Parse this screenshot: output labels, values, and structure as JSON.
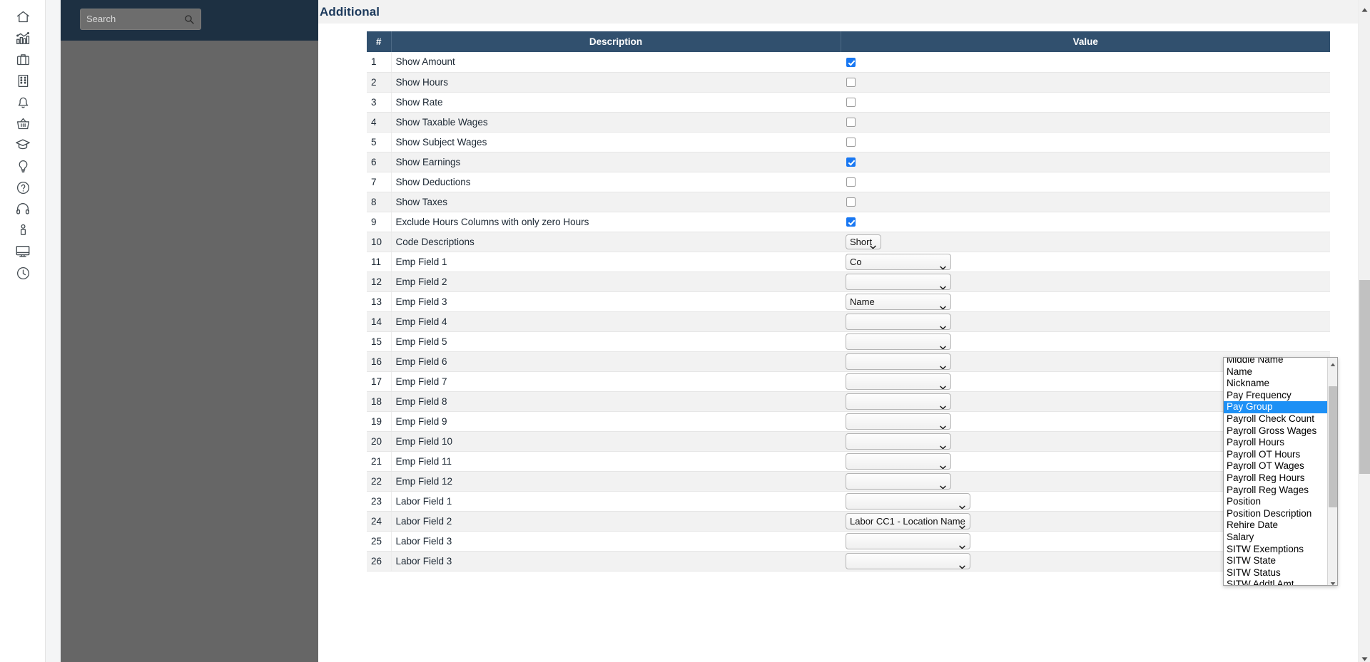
{
  "app": {
    "search": {
      "placeholder": "Search",
      "value": ""
    }
  },
  "sidebar": {
    "icons": [
      {
        "name": "home-icon",
        "label": "Home"
      },
      {
        "name": "analytics-icon",
        "label": "Analytics"
      },
      {
        "name": "briefcase-icon",
        "label": "Briefcase"
      },
      {
        "name": "company-building-icon",
        "label": "Company"
      },
      {
        "name": "bell-icon",
        "label": "Notifications"
      },
      {
        "name": "basket-icon",
        "label": "Marketplace"
      },
      {
        "name": "graduation-cap-icon",
        "label": "Learning"
      },
      {
        "name": "lightbulb-icon",
        "label": "Ideas"
      },
      {
        "name": "question-circle-icon",
        "label": "Help"
      },
      {
        "name": "headset-icon",
        "label": "Support"
      },
      {
        "name": "person-icon",
        "label": "Profile"
      },
      {
        "name": "monitor-icon",
        "label": "Display"
      },
      {
        "name": "clock-icon",
        "label": "Time"
      }
    ]
  },
  "section": {
    "title": "Additional"
  },
  "table": {
    "headers": {
      "num": "#",
      "description": "Description",
      "value": "Value"
    },
    "rows": [
      {
        "num": "1",
        "description": "Show Amount",
        "type": "checkbox",
        "checked": true
      },
      {
        "num": "2",
        "description": "Show Hours",
        "type": "checkbox",
        "checked": false
      },
      {
        "num": "3",
        "description": "Show Rate",
        "type": "checkbox",
        "checked": false
      },
      {
        "num": "4",
        "description": "Show Taxable Wages",
        "type": "checkbox",
        "checked": false
      },
      {
        "num": "5",
        "description": "Show Subject Wages",
        "type": "checkbox",
        "checked": false
      },
      {
        "num": "6",
        "description": "Show Earnings",
        "type": "checkbox",
        "checked": true
      },
      {
        "num": "7",
        "description": "Show Deductions",
        "type": "checkbox",
        "checked": false
      },
      {
        "num": "8",
        "description": "Show Taxes",
        "type": "checkbox",
        "checked": false
      },
      {
        "num": "9",
        "description": "Exclude Hours Columns with only zero Hours",
        "type": "checkbox",
        "checked": true
      },
      {
        "num": "10",
        "description": "Code Descriptions",
        "type": "select-short",
        "value": "Short"
      },
      {
        "num": "11",
        "description": "Emp Field 1",
        "type": "select-emp",
        "value": "Co"
      },
      {
        "num": "12",
        "description": "Emp Field 2",
        "type": "select-emp",
        "value": ""
      },
      {
        "num": "13",
        "description": "Emp Field 3",
        "type": "select-emp",
        "value": "Name"
      },
      {
        "num": "14",
        "description": "Emp Field 4",
        "type": "select-emp",
        "value": "",
        "open": true
      },
      {
        "num": "15",
        "description": "Emp Field 5",
        "type": "select-emp",
        "value": ""
      },
      {
        "num": "16",
        "description": "Emp Field 6",
        "type": "select-emp",
        "value": ""
      },
      {
        "num": "17",
        "description": "Emp Field 7",
        "type": "select-emp",
        "value": ""
      },
      {
        "num": "18",
        "description": "Emp Field 8",
        "type": "select-emp",
        "value": ""
      },
      {
        "num": "19",
        "description": "Emp Field 9",
        "type": "select-emp",
        "value": ""
      },
      {
        "num": "20",
        "description": "Emp Field 10",
        "type": "select-emp",
        "value": ""
      },
      {
        "num": "21",
        "description": "Emp Field 11",
        "type": "select-emp",
        "value": ""
      },
      {
        "num": "22",
        "description": "Emp Field 12",
        "type": "select-emp",
        "value": ""
      },
      {
        "num": "23",
        "description": "Labor Field 1",
        "type": "select-labor",
        "value": ""
      },
      {
        "num": "24",
        "description": "Labor Field 2",
        "type": "select-labor",
        "value": "Labor CC1 - Location Name"
      },
      {
        "num": "25",
        "description": "Labor Field 3",
        "type": "select-labor",
        "value": ""
      },
      {
        "num": "26",
        "description": "Labor Field 3",
        "type": "select-labor",
        "value": ""
      }
    ]
  },
  "dropdown": {
    "owner_row": "14",
    "selected": "Pay Group",
    "options": [
      "Middle Name",
      "Name",
      "Nickname",
      "Pay Frequency",
      "Pay Group",
      "Payroll Check Count",
      "Payroll Gross Wages",
      "Payroll Hours",
      "Payroll OT Hours",
      "Payroll OT Wages",
      "Payroll Reg Hours",
      "Payroll Reg Wages",
      "Position",
      "Position Description",
      "Rehire Date",
      "Salary",
      "SITW Exemptions",
      "SITW State",
      "SITW Status",
      "SITW Addtl Amt"
    ]
  },
  "colors": {
    "nav_panel": "#1d3042",
    "table_header": "#31506e",
    "section_title": "#1d3a5c",
    "checkbox_checked": "#1877f2",
    "dropdown_highlight": "#1d90f5",
    "nav_body": "#666666"
  }
}
